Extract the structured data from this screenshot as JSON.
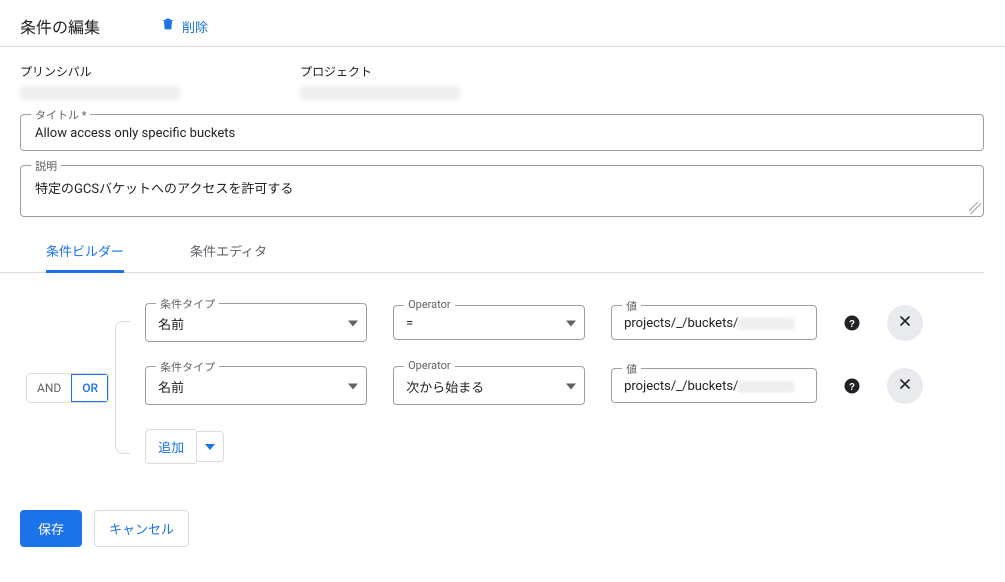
{
  "header": {
    "title": "条件の編集",
    "delete_label": "削除"
  },
  "info": {
    "principal_label": "プリンシパル",
    "project_label": "プロジェクト"
  },
  "title_field": {
    "label": "タイトル *",
    "value": "Allow access only specific buckets"
  },
  "description_field": {
    "label": "説明",
    "value": "特定のGCSバケットへのアクセスを許可する"
  },
  "tabs": {
    "builder": "条件ビルダー",
    "editor": "条件エディタ",
    "active": "builder"
  },
  "logic": {
    "and": "AND",
    "or": "OR",
    "active": "or"
  },
  "condition_labels": {
    "type": "条件タイプ",
    "operator": "Operator",
    "value": "値"
  },
  "conditions": [
    {
      "type": "名前",
      "operator": "=",
      "value_prefix": "projects/_/buckets/"
    },
    {
      "type": "名前",
      "operator": "次から始まる",
      "value_prefix": "projects/_/buckets/"
    }
  ],
  "add_label": "追加",
  "footer": {
    "save": "保存",
    "cancel": "キャンセル"
  }
}
